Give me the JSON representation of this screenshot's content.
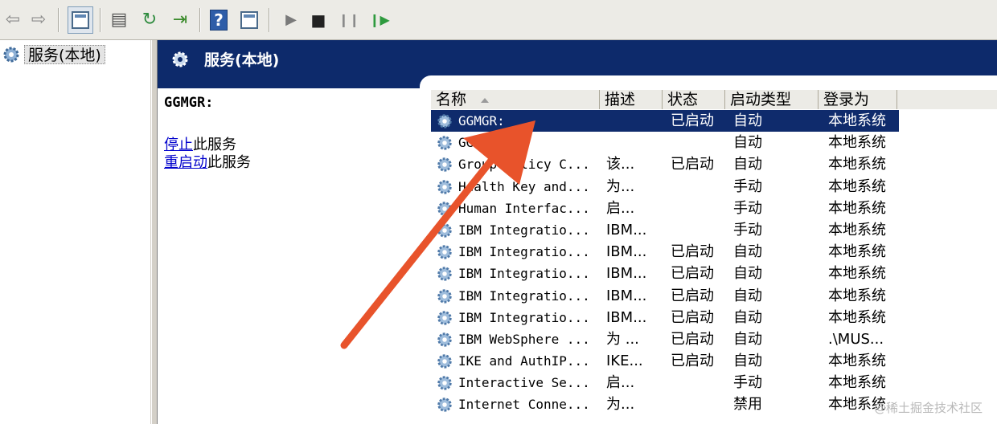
{
  "toolbar": {
    "buttons": [
      {
        "name": "back-icon",
        "glyph": "⇦"
      },
      {
        "name": "forward-icon",
        "glyph": "⇨"
      },
      {
        "name": "show-console-tree-icon",
        "glyph": ""
      },
      {
        "name": "properties-icon",
        "glyph": "▤"
      },
      {
        "name": "refresh-icon",
        "glyph": "↻"
      },
      {
        "name": "export-list-icon",
        "glyph": "⇥"
      },
      {
        "name": "help-icon",
        "glyph": "?"
      },
      {
        "name": "action-pane-icon",
        "glyph": ""
      },
      {
        "name": "start-service-icon",
        "glyph": "▶"
      },
      {
        "name": "stop-service-icon",
        "glyph": "■"
      },
      {
        "name": "pause-service-icon",
        "glyph": "❙❙"
      },
      {
        "name": "restart-service-icon",
        "glyph": "❙▶"
      }
    ]
  },
  "tree": {
    "root_label": "服务(本地)"
  },
  "banner": {
    "title": "服务(本地)"
  },
  "details": {
    "service_title": "GGMGR:",
    "stop_link": "停止",
    "stop_suffix": "此服务",
    "restart_link": "重启动",
    "restart_suffix": "此服务"
  },
  "table": {
    "columns": {
      "name": "名称",
      "description": "描述",
      "status": "状态",
      "startup_type": "启动类型",
      "logon_as": "登录为"
    },
    "rows": [
      {
        "name": "GGMGR:",
        "desc": "",
        "status": "已启动",
        "startup": "自动",
        "logon": "本地系统",
        "selected": true
      },
      {
        "name": "GGSMGR",
        "desc": "",
        "status": "",
        "startup": "自动",
        "logon": "本地系统",
        "selected": false
      },
      {
        "name": "Group Policy C...",
        "desc": "该...",
        "status": "已启动",
        "startup": "自动",
        "logon": "本地系统",
        "selected": false
      },
      {
        "name": "Health Key and...",
        "desc": "为...",
        "status": "",
        "startup": "手动",
        "logon": "本地系统",
        "selected": false
      },
      {
        "name": "Human Interfac...",
        "desc": "启...",
        "status": "",
        "startup": "手动",
        "logon": "本地系统",
        "selected": false
      },
      {
        "name": "IBM Integratio...",
        "desc": "IBM...",
        "status": "",
        "startup": "手动",
        "logon": "本地系统",
        "selected": false
      },
      {
        "name": "IBM Integratio...",
        "desc": "IBM...",
        "status": "已启动",
        "startup": "自动",
        "logon": "本地系统",
        "selected": false
      },
      {
        "name": "IBM Integratio...",
        "desc": "IBM...",
        "status": "已启动",
        "startup": "自动",
        "logon": "本地系统",
        "selected": false
      },
      {
        "name": "IBM Integratio...",
        "desc": "IBM...",
        "status": "已启动",
        "startup": "自动",
        "logon": "本地系统",
        "selected": false
      },
      {
        "name": "IBM Integratio...",
        "desc": "IBM...",
        "status": "已启动",
        "startup": "自动",
        "logon": "本地系统",
        "selected": false
      },
      {
        "name": "IBM WebSphere ...",
        "desc": "为 ...",
        "status": "已启动",
        "startup": "自动",
        "logon": ".\\MUS...",
        "selected": false
      },
      {
        "name": "IKE and AuthIP...",
        "desc": "IKE...",
        "status": "已启动",
        "startup": "自动",
        "logon": "本地系统",
        "selected": false
      },
      {
        "name": "Interactive Se...",
        "desc": "启...",
        "status": "",
        "startup": "手动",
        "logon": "本地系统",
        "selected": false
      },
      {
        "name": "Internet Conne...",
        "desc": "为...",
        "status": "",
        "startup": "禁用",
        "logon": "本地系统",
        "selected": false
      }
    ]
  },
  "colors": {
    "banner": "#0d2a6b",
    "selection": "#0f2b6c",
    "arrow": "#e8532b",
    "link": "#0000cc"
  },
  "watermark": "@稀土掘金技术社区"
}
